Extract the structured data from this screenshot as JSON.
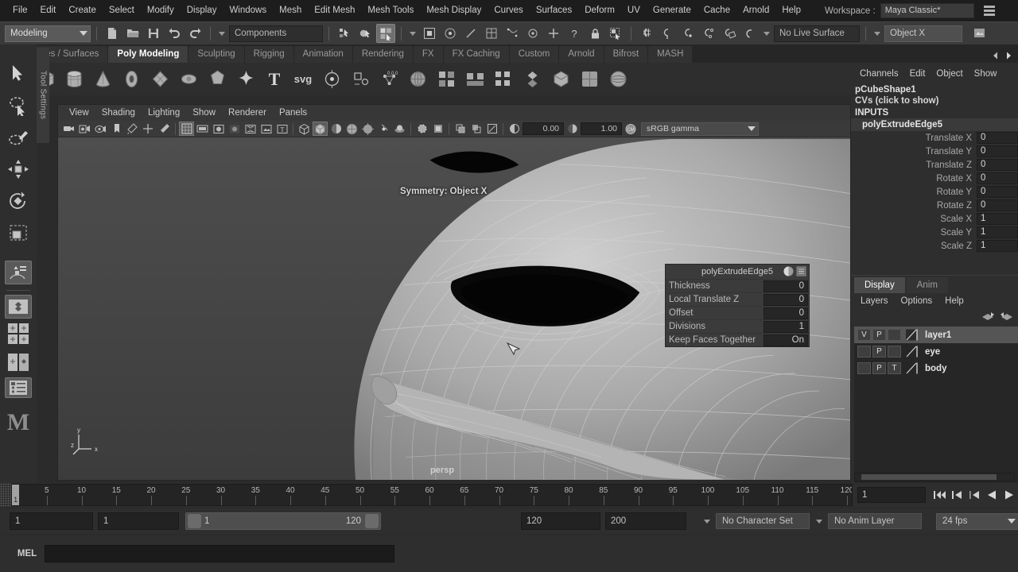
{
  "menubar": {
    "items": [
      "File",
      "Edit",
      "Create",
      "Select",
      "Modify",
      "Display",
      "Windows",
      "Mesh",
      "Edit Mesh",
      "Mesh Tools",
      "Mesh Display",
      "Curves",
      "Surfaces",
      "Deform",
      "UV",
      "Generate",
      "Cache",
      "Arnold",
      "Help"
    ],
    "workspace_label": "Workspace :",
    "workspace_value": "Maya Classic*"
  },
  "statusbar": {
    "menuset": "Modeling",
    "components_field": "Components",
    "live_surface": "No Live Surface",
    "symmetry_field": "Object X",
    "icons": [
      "new-scene-icon",
      "open-scene-icon",
      "save-scene-icon",
      "undo-icon",
      "redo-icon",
      "select-hierarchy-icon",
      "select-object-icon",
      "select-component-icon",
      "object-mask-icon",
      "render-mask-icon",
      "curve-mask-icon",
      "surface-mask-icon",
      "deform-mask-icon",
      "dynamic-mask-icon",
      "render-node-mask-icon",
      "misc-mask-icon",
      "question-icon",
      "lock-icon",
      "selection-highlight-icon",
      "snap-grid-icon",
      "snap-curve-icon",
      "snap-point-icon",
      "snap-projected-icon",
      "snap-view-plane-icon",
      "make-live-icon",
      "render-view-icon"
    ]
  },
  "shelf": {
    "tabs": [
      "Curves / Surfaces",
      "Poly Modeling",
      "Sculpting",
      "Rigging",
      "Animation",
      "Rendering",
      "FX",
      "FX Caching",
      "Custom",
      "Arnold",
      "Bifrost",
      "MASH"
    ],
    "active_tab": "Poly Modeling",
    "icons": [
      "poly-sphere-icon",
      "poly-cube-icon",
      "poly-cylinder-icon",
      "poly-cone-icon",
      "poly-torus-icon",
      "poly-plane-icon",
      "poly-platonic-icon",
      "poly-prism-icon",
      "poly-pyramid-icon",
      "poly-type-icon",
      "poly-svg-icon",
      "poly-sculpt-icon",
      "poly-quad-draw-icon",
      "poly-multi-cut-icon",
      "poly-combine-icon",
      "poly-bevel-icon",
      "poly-bridge-icon",
      "poly-extrude-icon",
      "poly-mirror-icon",
      "poly-smooth-icon",
      "poly-reduce-icon",
      "poly-remesh-icon",
      "poly-retopo-icon"
    ]
  },
  "toolbox": {
    "tools": [
      "select-tool-icon",
      "lasso-select-tool-icon",
      "paint-select-tool-icon",
      "move-tool-icon",
      "rotate-tool-icon",
      "scale-tool-icon",
      "last-tool-icon",
      "single-pane-layout-icon",
      "two-pane-layout-icon",
      "three-pane-layout-icon",
      "outliner-layout-icon",
      "maya-logo-icon"
    ],
    "tool_settings_tab": "Tool Settings"
  },
  "viewport": {
    "menus": [
      "View",
      "Shading",
      "Lighting",
      "Show",
      "Renderer",
      "Panels"
    ],
    "exposure_value": "0.00",
    "gamma_value": "1.00",
    "color_profile": "sRGB gamma",
    "symmetry_hud": "Symmetry: Object X",
    "camera_label": "persp",
    "axis_labels": [
      "y",
      "z",
      "x"
    ],
    "toolbar_icons": [
      "select-camera-icon",
      "camera-attributes-icon",
      "bookmarks-icon",
      "image-plane-icon",
      "two-d-pan-zoom-icon",
      "grease-pencil-icon",
      "grid-toggle-icon",
      "film-gate-icon",
      "resolution-gate-icon",
      "gate-mask-icon",
      "film-origin-icon",
      "image-plane-toggle-icon",
      "hud-toggle-icon",
      "wireframe-icon",
      "smooth-shade-icon",
      "shaded-wireframe-icon",
      "textured-icon",
      "lighting-toggle-icon",
      "shadows-icon",
      "screen-space-ao-icon",
      "motion-blur-icon",
      "multisample-icon",
      "depth-peel-icon",
      "xray-icon",
      "xray-joints-icon",
      "xray-active-icon",
      "exposure-icon",
      "gamma-icon",
      "color-management-icon"
    ]
  },
  "node_popup": {
    "title": "polyExtrudeEdge5",
    "rows": [
      {
        "label": "Thickness",
        "value": "0"
      },
      {
        "label": "Local Translate Z",
        "value": "0"
      },
      {
        "label": "Offset",
        "value": "0"
      },
      {
        "label": "Divisions",
        "value": "1"
      },
      {
        "label": "Keep Faces Together",
        "value": "On"
      }
    ]
  },
  "channelbox": {
    "menus": [
      "Channels",
      "Edit",
      "Object",
      "Show"
    ],
    "shape_name": "pCubeShape1",
    "cvs_row": "CVs (click to show)",
    "inputs_title": "INPUTS",
    "input_node": "polyExtrudeEdge5",
    "attributes": [
      {
        "name": "Translate X",
        "value": "0"
      },
      {
        "name": "Translate Y",
        "value": "0"
      },
      {
        "name": "Translate Z",
        "value": "0"
      },
      {
        "name": "Rotate X",
        "value": "0"
      },
      {
        "name": "Rotate Y",
        "value": "0"
      },
      {
        "name": "Rotate Z",
        "value": "0"
      },
      {
        "name": "Scale X",
        "value": "1"
      },
      {
        "name": "Scale Y",
        "value": "1"
      },
      {
        "name": "Scale Z",
        "value": "1"
      }
    ]
  },
  "layereditor": {
    "tabs": [
      "Display",
      "Anim"
    ],
    "active_tab": "Display",
    "menus": [
      "Layers",
      "Options",
      "Help"
    ],
    "layers": [
      {
        "name": "layer1",
        "visibility": "V",
        "playback": "P",
        "type": "",
        "selected": true
      },
      {
        "name": "eye",
        "visibility": "",
        "playback": "P",
        "type": "",
        "selected": false
      },
      {
        "name": "body",
        "visibility": "",
        "playback": "P",
        "type": "T",
        "selected": false
      }
    ]
  },
  "timeslider": {
    "ticks": [
      5,
      10,
      15,
      20,
      25,
      30,
      35,
      40,
      45,
      50,
      55,
      60,
      65,
      70,
      75,
      80,
      85,
      90,
      95,
      100,
      105,
      110,
      115,
      120
    ],
    "range_start": 1,
    "range_end": 120,
    "current_frame": "1",
    "frame_field": "1",
    "playback_buttons": [
      "go-to-start-icon",
      "step-back-frame-icon",
      "step-back-key-icon",
      "play-backwards-icon",
      "play-forwards-icon"
    ]
  },
  "rangeslider": {
    "anim_start": "1",
    "range_start": "1",
    "slider_start": "1",
    "slider_end": "120",
    "range_end": "120",
    "anim_end": "200",
    "character_set": "No Character Set",
    "anim_layer": "No Anim Layer",
    "fps": "24 fps",
    "loop_icon": "loop-playback-icon"
  },
  "commandline": {
    "mode_label": "MEL",
    "input_value": "",
    "output_value": ""
  },
  "colors": {
    "window_bg": "#2e2e2e",
    "menubar_bg": "#1d1d1d",
    "toolbar_bg": "#3a3a3a",
    "field_bg": "#262626",
    "highlight": "#5a5a5a",
    "text": "#c8c8c8"
  }
}
